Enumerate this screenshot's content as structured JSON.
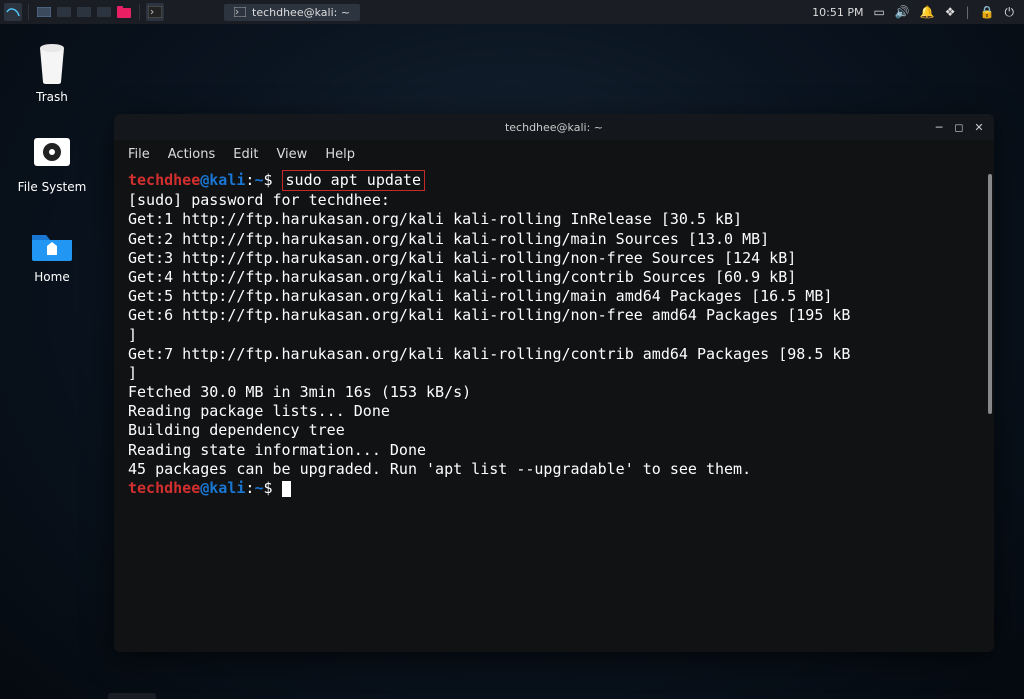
{
  "taskbar": {
    "task_title": "techdhee@kali: ~",
    "time": "10:51 PM"
  },
  "desktop": {
    "trash": "Trash",
    "filesystem": "File System",
    "home": "Home"
  },
  "terminal": {
    "title": "techdhee@kali: ~",
    "menus": [
      "File",
      "Actions",
      "Edit",
      "View",
      "Help"
    ],
    "prompt": {
      "user": "techdhee",
      "at": "@",
      "host": "kali",
      "colon": ":",
      "path": "~",
      "dollar": "$"
    },
    "command": "sudo apt update",
    "lines": [
      "[sudo] password for techdhee:",
      "Get:1 http://ftp.harukasan.org/kali kali-rolling InRelease [30.5 kB]",
      "Get:2 http://ftp.harukasan.org/kali kali-rolling/main Sources [13.0 MB]",
      "Get:3 http://ftp.harukasan.org/kali kali-rolling/non-free Sources [124 kB]",
      "Get:4 http://ftp.harukasan.org/kali kali-rolling/contrib Sources [60.9 kB]",
      "Get:5 http://ftp.harukasan.org/kali kali-rolling/main amd64 Packages [16.5 MB]",
      "Get:6 http://ftp.harukasan.org/kali kali-rolling/non-free amd64 Packages [195 kB]",
      "Get:7 http://ftp.harukasan.org/kali kali-rolling/contrib amd64 Packages [98.5 kB]",
      "Fetched 30.0 MB in 3min 16s (153 kB/s)",
      "Reading package lists... Done",
      "Building dependency tree",
      "Reading state information... Done",
      "45 packages can be upgraded. Run 'apt list --upgradable' to see them."
    ]
  }
}
